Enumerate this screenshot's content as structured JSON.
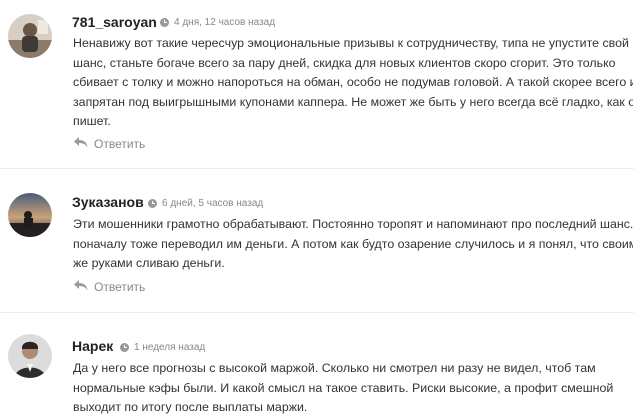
{
  "comments": [
    {
      "author": "781_saroyan",
      "time": "4 дня, 12 часов назад",
      "lines": [
        "Ненавижу вот такие чересчур эмоциональные призывы к сотрудничеству, типа не упустите свой",
        "шанс, станьте богаче всего за пару дней, скидка для новых клиентов скоро сгорит. Это только",
        "сбивает с толку и можно напороться на обман, особо не подумав головой. А такой скорее всего и",
        "запрятан под выигрышными купонами каппера. Не может же быть у него всегда всё гладко, как он",
        "пишет."
      ],
      "reply": "Ответить"
    },
    {
      "author": "Зуказанов",
      "time": "6 дней, 5 часов назад",
      "lines": [
        "Эти мошенники грамотно обрабатывают. Постоянно торопят и напоминают про последний шанс. Я",
        "поначалу тоже переводил им деньги. А потом как будто озарение случилось и я понял, что своими",
        "же руками сливаю деньги."
      ],
      "reply": "Ответить"
    },
    {
      "author": "Нарек",
      "time": "1 неделя назад",
      "lines": [
        "Да у него все прогнозы с высокой маржой. Сколько ни смотрел ни разу не видел, чтоб там",
        "нормальные кэфы были. И какой смысл на такое ставить. Риски высокие, а профит смешной",
        "выходит по итогу после выплаты маржи."
      ]
    }
  ]
}
